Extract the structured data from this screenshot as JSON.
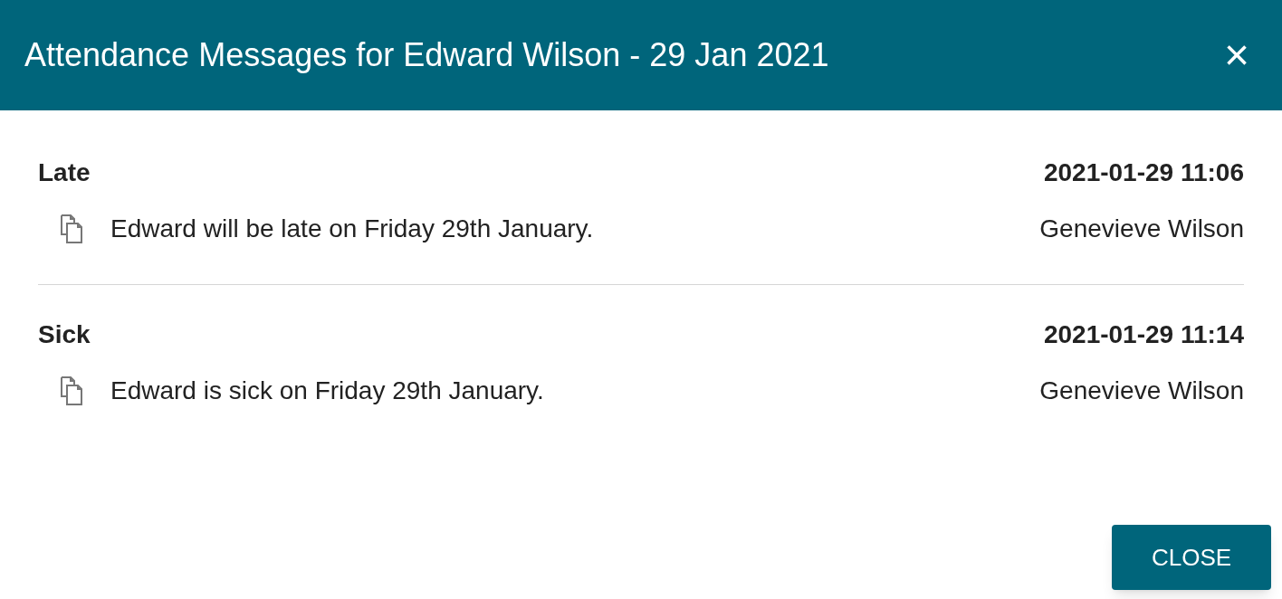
{
  "dialog": {
    "title": "Attendance Messages for Edward Wilson - 29 Jan 2021",
    "close_icon": "×"
  },
  "messages": [
    {
      "type": "Late",
      "timestamp": "2021-01-29 11:06",
      "text": "Edward will be late on Friday 29th January.",
      "author": "Genevieve Wilson"
    },
    {
      "type": "Sick",
      "timestamp": "2021-01-29 11:14",
      "text": "Edward is sick on Friday 29th January.",
      "author": "Genevieve Wilson"
    }
  ],
  "buttons": [
    "CLOSE"
  ]
}
